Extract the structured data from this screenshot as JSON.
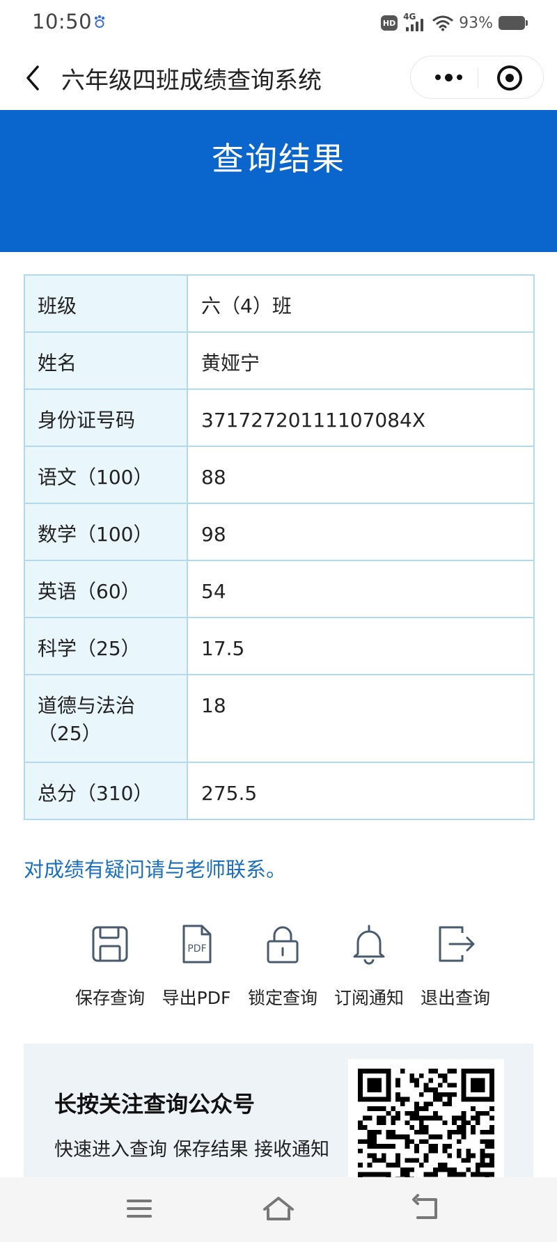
{
  "status_bar": {
    "time": "10:50",
    "network": "4G",
    "hd": "HD",
    "battery": "93%",
    "icons": [
      "paw-icon",
      "hd-icon",
      "signal-4g-icon",
      "wifi-icon",
      "battery-icon"
    ]
  },
  "nav": {
    "title": "六年级四班成绩查询系统",
    "icons": [
      "back-icon",
      "more-icon",
      "target-icon"
    ]
  },
  "banner": {
    "title": "查询结果"
  },
  "result_table": {
    "rows": [
      {
        "label": "班级",
        "value": "六（4）班"
      },
      {
        "label": "姓名",
        "value": "黄娅宁"
      },
      {
        "label": "身份证号码",
        "value": "37172720111107084X"
      },
      {
        "label": "语文（100）",
        "value": "88"
      },
      {
        "label": "数学（100）",
        "value": "98"
      },
      {
        "label": "英语（60）",
        "value": "54"
      },
      {
        "label": "科学（25）",
        "value": "17.5"
      },
      {
        "label": "道德与法治（25）",
        "value": "18"
      },
      {
        "label": "总分（310）",
        "value": "275.5"
      }
    ]
  },
  "note": "对成绩有疑问请与老师联系。",
  "actions": [
    {
      "label": "保存查询",
      "icon": "save-icon"
    },
    {
      "label": "导出PDF",
      "icon": "pdf-icon"
    },
    {
      "label": "锁定查询",
      "icon": "lock-icon"
    },
    {
      "label": "订阅通知",
      "icon": "bell-icon"
    },
    {
      "label": "退出查询",
      "icon": "logout-icon"
    }
  ],
  "follow_card": {
    "title": "长按关注查询公众号",
    "description": "快速进入查询 保存结果 接收通知"
  },
  "bottom_nav": {
    "icons": [
      "menu-icon",
      "home-icon",
      "return-icon"
    ]
  },
  "colors": {
    "banner": "#0a66cc",
    "table_border": "#b3d9ec",
    "label_bg": "#e9f6fc",
    "note": "#1a6fbf",
    "icon": "#4a5a6e"
  }
}
